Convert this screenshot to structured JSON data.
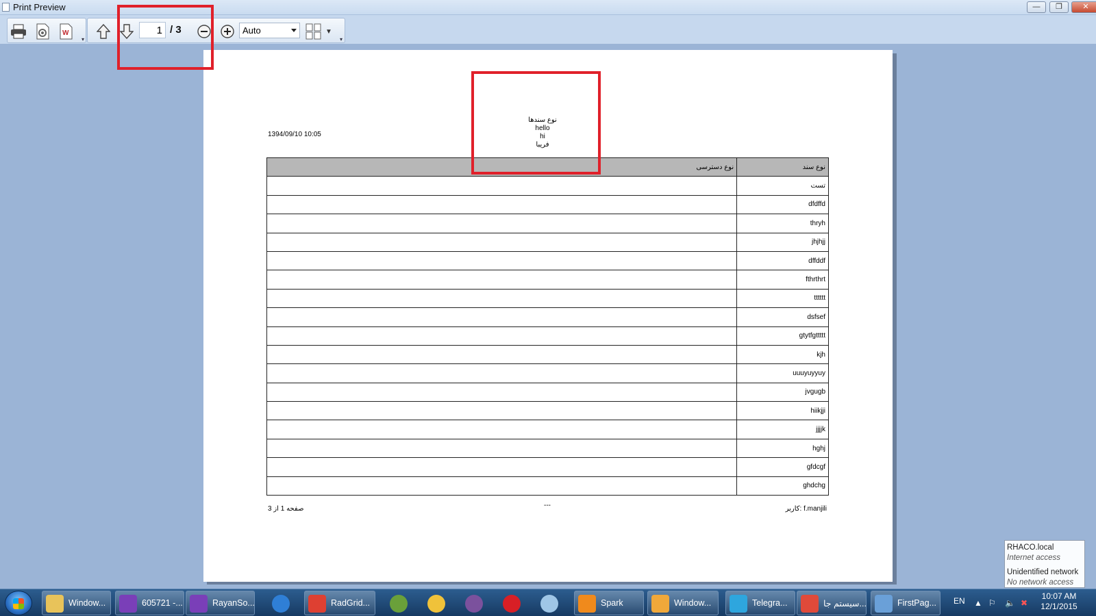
{
  "window": {
    "title": "Print Preview",
    "minimize": "—",
    "restore": "❐",
    "close": "✕"
  },
  "toolbar": {
    "current_page": "1",
    "page_total": "/ 3",
    "zoom_value": "Auto"
  },
  "report": {
    "date": "1394/09/10 10:05",
    "header_lines": [
      "نوع سندها",
      "hello",
      "hi",
      "فریبا"
    ],
    "columns": [
      "نوع دسترسی",
      "نوع سند"
    ],
    "rows": [
      [
        "",
        "تست"
      ],
      [
        "",
        "dfdffd"
      ],
      [
        "",
        "thryh"
      ],
      [
        "",
        "jhjhjj"
      ],
      [
        "",
        "dffddf"
      ],
      [
        "",
        "fthrthrt"
      ],
      [
        "",
        "tttttt"
      ],
      [
        "",
        "dsfsef"
      ],
      [
        "",
        "gtytfgttttt"
      ],
      [
        "",
        "kjh"
      ],
      [
        "",
        "uuuyuyyuy"
      ],
      [
        "",
        "jvgugb"
      ],
      [
        "",
        "hiikjji"
      ],
      [
        "",
        "jjjjk"
      ],
      [
        "",
        "hghj"
      ],
      [
        "",
        "gfdcgf"
      ],
      [
        "",
        "ghdchg"
      ]
    ],
    "footer_left": "صفحه 1 از 3",
    "footer_center": "---",
    "footer_right": "کاربر: f.manjili"
  },
  "network_popup": {
    "domain": "RHACO.local",
    "domain_status": "Internet access",
    "network": "Unidentified network",
    "network_status": "No network access"
  },
  "taskbar": {
    "items": [
      {
        "label": "Window...",
        "color": "#e8c35a"
      },
      {
        "label": "605721 -...",
        "color": "#7a3fb8"
      },
      {
        "label": "RayanSo...",
        "color": "#7a3fb8"
      },
      {
        "label": "",
        "color": "#2f7fd6"
      },
      {
        "label": "RadGrid...",
        "color": "#de4032"
      },
      {
        "label": "",
        "color": "#6aa03a"
      },
      {
        "label": "",
        "color": "#f0c23a"
      },
      {
        "label": "",
        "color": "#7b519d"
      },
      {
        "label": "",
        "color": "#d81f26"
      },
      {
        "label": "",
        "color": "#9fc6e6"
      },
      {
        "label": "Spark",
        "color": "#f08a1c"
      },
      {
        "label": "Window...",
        "color": "#f0a83a"
      },
      {
        "label": "Telegra...",
        "color": "#2ea6de"
      },
      {
        "label": "سیستم جا...",
        "color": "#e04a3a"
      },
      {
        "label": "FirstPag...",
        "color": "#6aa0d8"
      }
    ],
    "language": "EN",
    "time": "10:07 AM",
    "date": "12/1/2015"
  }
}
